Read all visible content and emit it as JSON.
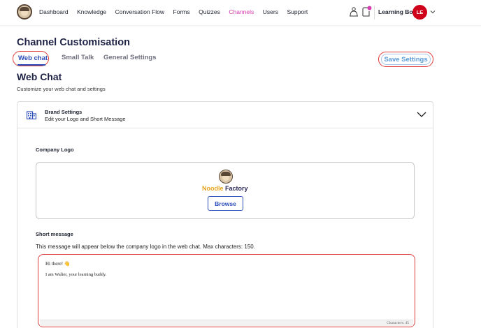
{
  "nav": {
    "items": [
      "Dashboard",
      "Knowledge",
      "Conversation Flow",
      "Forms",
      "Quizzes",
      "Channels",
      "Users",
      "Support"
    ],
    "active": "Channels",
    "bot_name": "Learning Bot",
    "avatar_initials": "LE",
    "icons": [
      "user-bell-icon",
      "notification-icon",
      "chevron-down-icon"
    ]
  },
  "page": {
    "title": "Channel Customisation",
    "tabs": [
      "Web chat",
      "Small Talk",
      "General Settings"
    ],
    "active_tab": "Web chat",
    "save_label": "Save Settings"
  },
  "section": {
    "title": "Web Chat",
    "subtitle": "Customize your web chat and settings"
  },
  "brand_settings": {
    "title": "Brand Settings",
    "subtitle": "Edit your Logo and Short Message",
    "company_logo_label": "Company Logo",
    "logo_text_1": "Noodle",
    "logo_text_2": " Factory",
    "browse_label": "Browse",
    "short_message_label": "Short message",
    "short_message_help": "This message will appear below the company logo in the web chat. Max characters: 150.",
    "message_line1": "Hi there! 👋",
    "message_line2": "I am Walter, your learning buddy.",
    "char_count": "Characters: 45"
  },
  "colors": {
    "accent": "#2b4eb8",
    "active_nav": "#d63bb0",
    "highlight": "#e03a3a",
    "avatar": "#d0021b"
  }
}
